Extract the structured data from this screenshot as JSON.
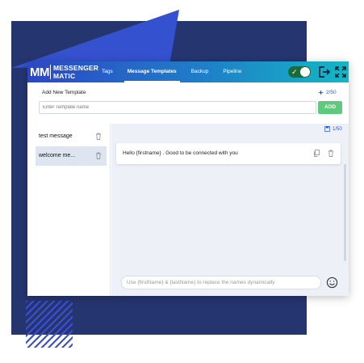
{
  "brand": {
    "logo_mark": "MM",
    "logo_text_line1": "MESSENGER",
    "logo_text_line2": "MATIC",
    "primary_color": "#2d47c4",
    "secondary_color": "#14b7c4"
  },
  "nav": {
    "tabs": [
      {
        "label": "Tags",
        "active": false
      },
      {
        "label": "Message Templates",
        "active": true
      },
      {
        "label": "Backup",
        "active": false
      },
      {
        "label": "Pipeline",
        "active": false
      }
    ]
  },
  "header_controls": {
    "toggle_on": true,
    "logout_icon": "logout-icon",
    "expand_icon": "expand-icon"
  },
  "add_template": {
    "label": "Add New Template",
    "counter": "2/50",
    "placeholder": "Enter Template name",
    "add_button": "ADD",
    "add_color": "#5fca7e"
  },
  "templates": [
    {
      "name": "test message",
      "selected": false
    },
    {
      "name": "welcome me...",
      "selected": true
    }
  ],
  "messages_panel": {
    "counter": "1/50",
    "messages": [
      {
        "text": "Hello {firstname} . Good to be connected with you"
      }
    ],
    "input_placeholder": "Use {firstName} & {lastName} to replace the names dynamically"
  }
}
